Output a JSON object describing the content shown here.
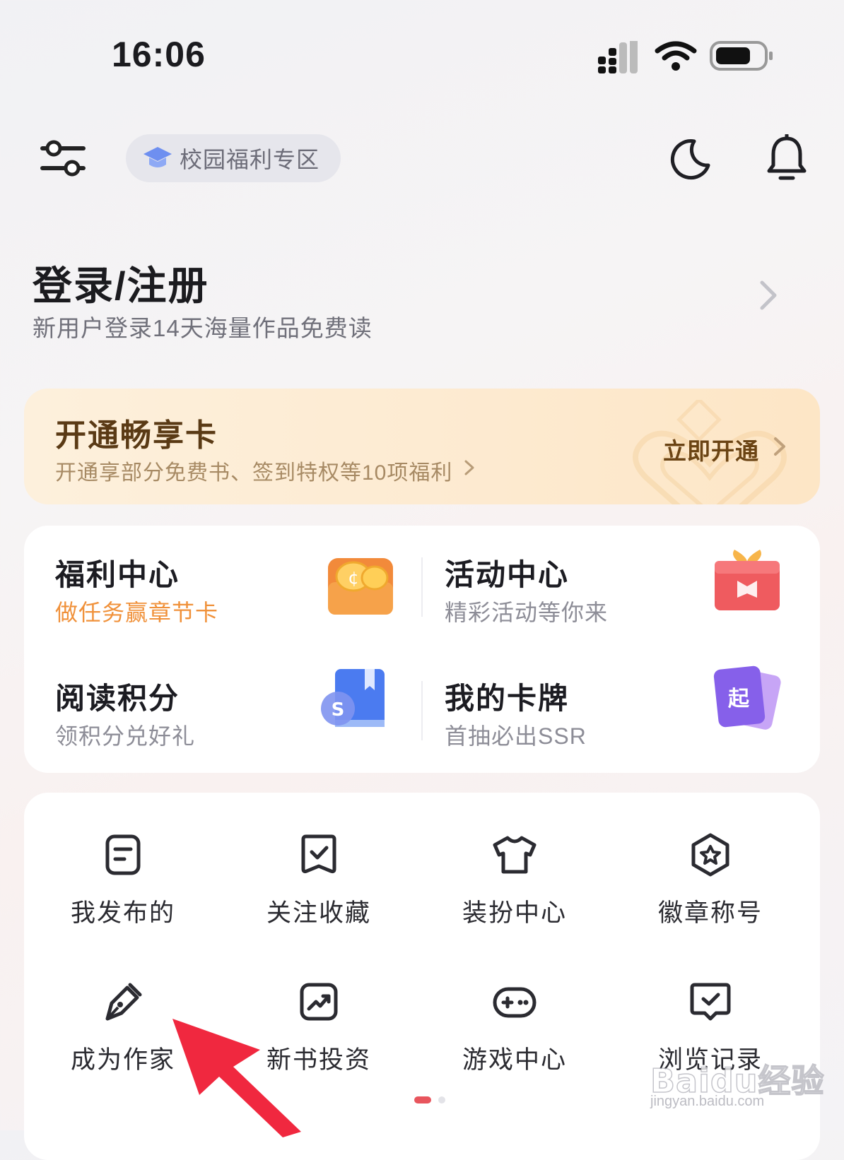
{
  "status_bar": {
    "time": "16:06"
  },
  "header": {
    "campus_label": "校园福利专区"
  },
  "login": {
    "title": "登录/注册",
    "subtitle": "新用户登录14天海量作品免费读"
  },
  "vip": {
    "title": "开通畅享卡",
    "subtitle": "开通享部分免费书、签到特权等10项福利",
    "action": "立即开通"
  },
  "welfare": [
    {
      "title": "福利中心",
      "subtitle": "做任务赢章节卡"
    },
    {
      "title": "活动中心",
      "subtitle": "精彩活动等你来"
    },
    {
      "title": "阅读积分",
      "subtitle": "领积分兑好礼"
    },
    {
      "title": "我的卡牌",
      "subtitle": "首抽必出SSR"
    }
  ],
  "menu": [
    {
      "label": "我发布的",
      "icon": "document-icon"
    },
    {
      "label": "关注收藏",
      "icon": "bookmark-check-icon"
    },
    {
      "label": "装扮中心",
      "icon": "tshirt-icon"
    },
    {
      "label": "徽章称号",
      "icon": "badge-star-icon"
    },
    {
      "label": "成为作家",
      "icon": "pen-icon"
    },
    {
      "label": "新书投资",
      "icon": "trend-chart-icon"
    },
    {
      "label": "游戏中心",
      "icon": "gamepad-icon"
    },
    {
      "label": "浏览记录",
      "icon": "history-book-icon"
    }
  ],
  "watermark": {
    "brand": "Baidu经验",
    "url": "jingyan.baidu.com"
  },
  "colors": {
    "accent": "#e8555d",
    "vip_text": "#5a3a15",
    "orange_sub": "#f0913a"
  }
}
